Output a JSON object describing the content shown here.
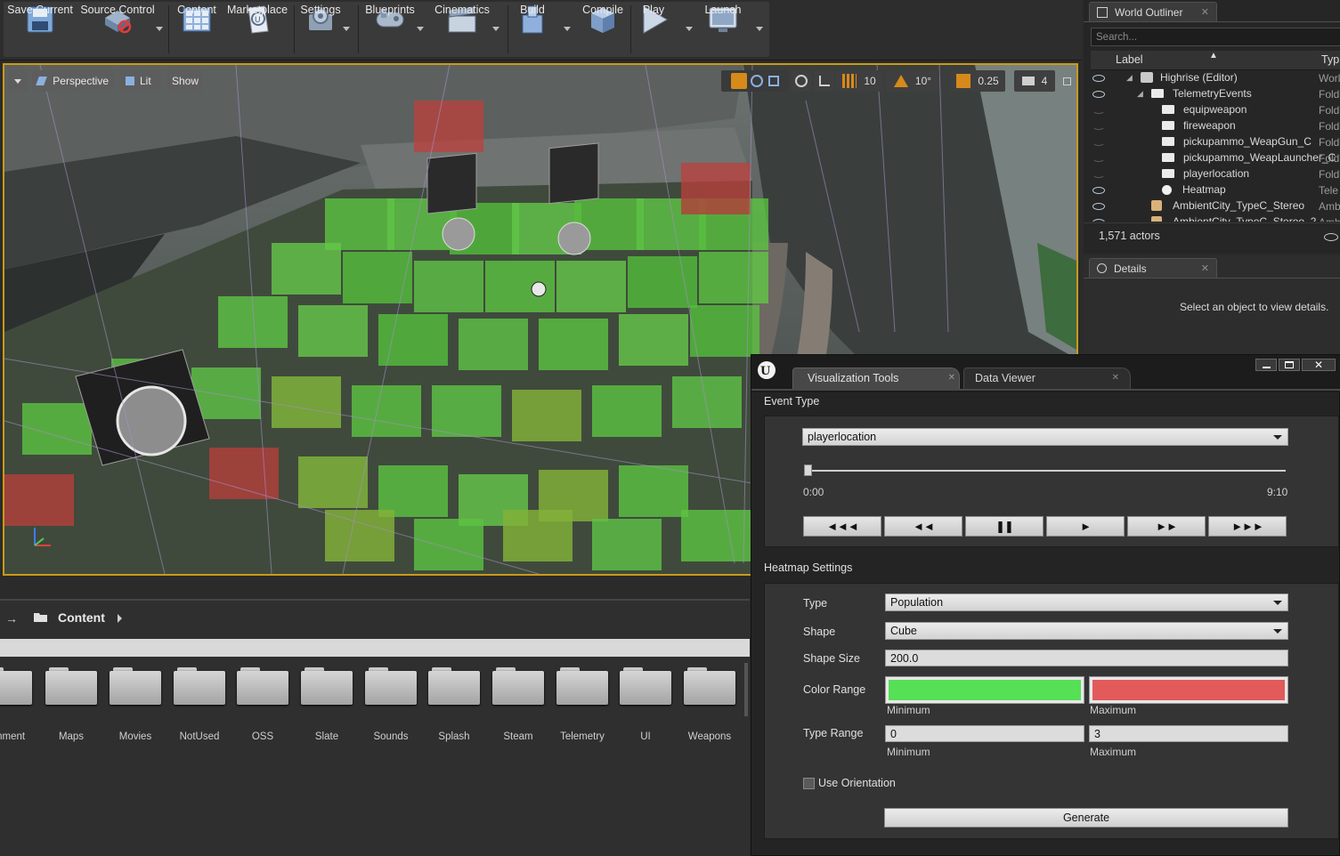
{
  "toolbar": {
    "buttons": [
      {
        "label": "Save Current",
        "icon": "save-icon"
      },
      {
        "label": "Source Control",
        "icon": "source-control-icon"
      },
      {
        "label": "Content",
        "icon": "content-icon"
      },
      {
        "label": "Marketplace",
        "icon": "marketplace-icon"
      },
      {
        "label": "Settings",
        "icon": "settings-icon"
      },
      {
        "label": "Blueprints",
        "icon": "blueprints-icon"
      },
      {
        "label": "Cinematics",
        "icon": "cinematics-icon"
      },
      {
        "label": "Build",
        "icon": "build-icon"
      },
      {
        "label": "Compile",
        "icon": "compile-icon"
      },
      {
        "label": "Play",
        "icon": "play-icon"
      },
      {
        "label": "Launch",
        "icon": "launch-icon"
      }
    ]
  },
  "viewport": {
    "perspective": "Perspective",
    "lit": "Lit",
    "show": "Show",
    "grid_snap": "10",
    "rotation_snap": "10°",
    "scale_snap": "0.25",
    "camera_speed": "4"
  },
  "content_browser": {
    "path": "Content",
    "folders": [
      "ronment",
      "Maps",
      "Movies",
      "NotUsed",
      "OSS",
      "Slate",
      "Sounds",
      "Splash",
      "Steam",
      "Telemetry",
      "UI",
      "Weapons"
    ]
  },
  "outliner": {
    "tab": "World Outliner",
    "search_placeholder": "Search...",
    "col_label": "Label",
    "col_type": "Typ",
    "rows": [
      {
        "label": "Highrise (Editor)",
        "type": "Worl"
      },
      {
        "label": "TelemetryEvents",
        "type": "Fold"
      },
      {
        "label": "equipweapon",
        "type": "Fold"
      },
      {
        "label": "fireweapon",
        "type": "Fold"
      },
      {
        "label": "pickupammo_WeapGun_C",
        "type": "Fold"
      },
      {
        "label": "pickupammo_WeapLauncher_C",
        "type": "Fold"
      },
      {
        "label": "playerlocation",
        "type": "Fold"
      },
      {
        "label": "Heatmap",
        "type": "Tele"
      },
      {
        "label": "AmbientCity_TypeC_Stereo",
        "type": "Amb"
      },
      {
        "label": "AmbientCity_TypeC_Stereo_2",
        "type": "Amb"
      }
    ],
    "actor_count": "1,571 actors"
  },
  "details": {
    "tab": "Details",
    "empty_text": "Select an object to view details."
  },
  "vis_tools": {
    "tab_active": "Visualization Tools",
    "tab_other": "Data Viewer",
    "event_type_title": "Event Type",
    "event_type_value": "playerlocation",
    "time_start": "0:00",
    "time_end": "9:10",
    "playback": [
      "◄◄◄",
      "◄◄",
      "❚❚",
      "►",
      "►►",
      "►►►"
    ],
    "heatmap_title": "Heatmap Settings",
    "type_label": "Type",
    "type_value": "Population",
    "shape_label": "Shape",
    "shape_value": "Cube",
    "shape_size_label": "Shape Size",
    "shape_size_value": "200.0",
    "color_range_label": "Color Range",
    "color_min": "#55e055",
    "color_max": "#e25a5a",
    "minimum": "Minimum",
    "maximum": "Maximum",
    "type_range_label": "Type Range",
    "type_range_min": "0",
    "type_range_max": "3",
    "use_orientation": "Use Orientation",
    "generate": "Generate"
  }
}
